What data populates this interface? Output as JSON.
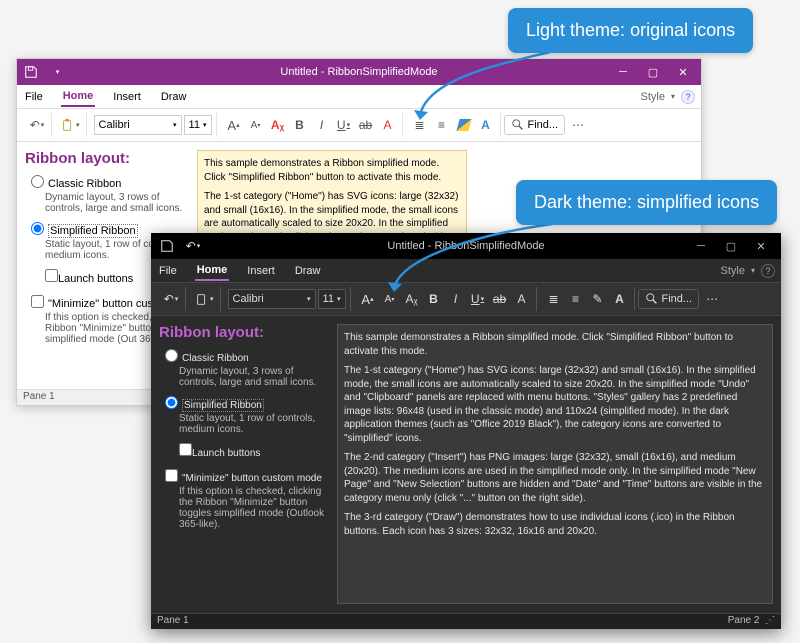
{
  "callouts": {
    "light": "Light theme: original icons",
    "dark": "Dark theme: simplified icons"
  },
  "light": {
    "title": "Untitled - RibbonSimplifiedMode",
    "tabs": {
      "file": "File",
      "home": "Home",
      "insert": "Insert",
      "draw": "Draw",
      "style": "Style"
    },
    "font": {
      "name": "Calibri",
      "size": "11"
    },
    "find": "Find...",
    "layout_heading": "Ribbon layout:",
    "opt_classic": "Classic Ribbon",
    "opt_classic_desc": "Dynamic layout, 3 rows of controls, large and small icons.",
    "opt_simplified": "Simplified Ribbon",
    "opt_simplified_desc": "Static layout, 1 row of contr\nmedium icons.",
    "chk_launch": "Launch buttons",
    "chk_minimize": "\"Minimize\" button custom m",
    "chk_minimize_desc": "If this option is checked, cli\nthe Ribbon \"Minimize\" butto\ntoggles simplified mode (Out\n365-like).",
    "info_p1": "This sample demonstrates a Ribbon simplified mode. Click \"Simplified Ribbon\" button to activate this mode.",
    "info_p2": "The 1-st category (\"Home\") has SVG icons: large (32x32) and small (16x16). In the simplified mode, the small icons are automatically scaled to size 20x20. In the simplified mode \"Undo\" and \"Clipboard\" panels are replaced with menu buttons. \"Styles\" gallery has 2 predefined image lists: 96x48 (used in the classic mode) and 110x24 (simplified",
    "status_left": "Pane 1"
  },
  "dark": {
    "title": "Untitled - RibbonSimplifiedMode",
    "tabs": {
      "file": "File",
      "home": "Home",
      "insert": "Insert",
      "draw": "Draw",
      "style": "Style"
    },
    "font": {
      "name": "Calibri",
      "size": "11"
    },
    "find": "Find...",
    "layout_heading": "Ribbon layout:",
    "opt_classic": "Classic Ribbon",
    "opt_classic_desc": "Dynamic layout, 3 rows of controls, large and small icons.",
    "opt_simplified": "Simplified Ribbon",
    "opt_simplified_desc": "Static layout, 1 row of controls, medium icons.",
    "chk_launch": "Launch buttons",
    "chk_minimize": "\"Minimize\" button custom mode",
    "chk_minimize_desc": "If this option is checked, clicking the Ribbon \"Minimize\" button toggles simplified mode (Outlook 365-like).",
    "info_p1": "This sample demonstrates a Ribbon simplified mode. Click \"Simplified Ribbon\" button to activate this mode.",
    "info_p2": "The 1-st category (\"Home\") has SVG icons: large (32x32) and small (16x16). In the simplified mode, the small icons are automatically scaled to size 20x20. In the simplified mode \"Undo\" and \"Clipboard\" panels are replaced with menu buttons. \"Styles\" gallery has 2 predefined image lists: 96x48 (used in the classic mode) and 110x24 (simplified mode). In the dark application themes (such as \"Office 2019 Black\"), the category icons are converted to \"simplified\" icons.",
    "info_p3": "The 2-nd category (\"Insert\") has PNG images: large (32x32), small (16x16), and medium (20x20). The medium icons are used in the simplified mode only. In the simplified mode \"New Page\" and \"New Selection\" buttons are hidden and \"Date\" and \"Time\" buttons are visible in the category menu only (click \"...\" button on the right side).",
    "info_p4": "The 3-rd category (\"Draw\") demonstrates how to use individual icons (.ico) in the Ribbon buttons. Each icon has 3 sizes: 32x32, 16x16 and 20x20.",
    "status_left": "Pane 1",
    "status_right": "Pane 2"
  }
}
